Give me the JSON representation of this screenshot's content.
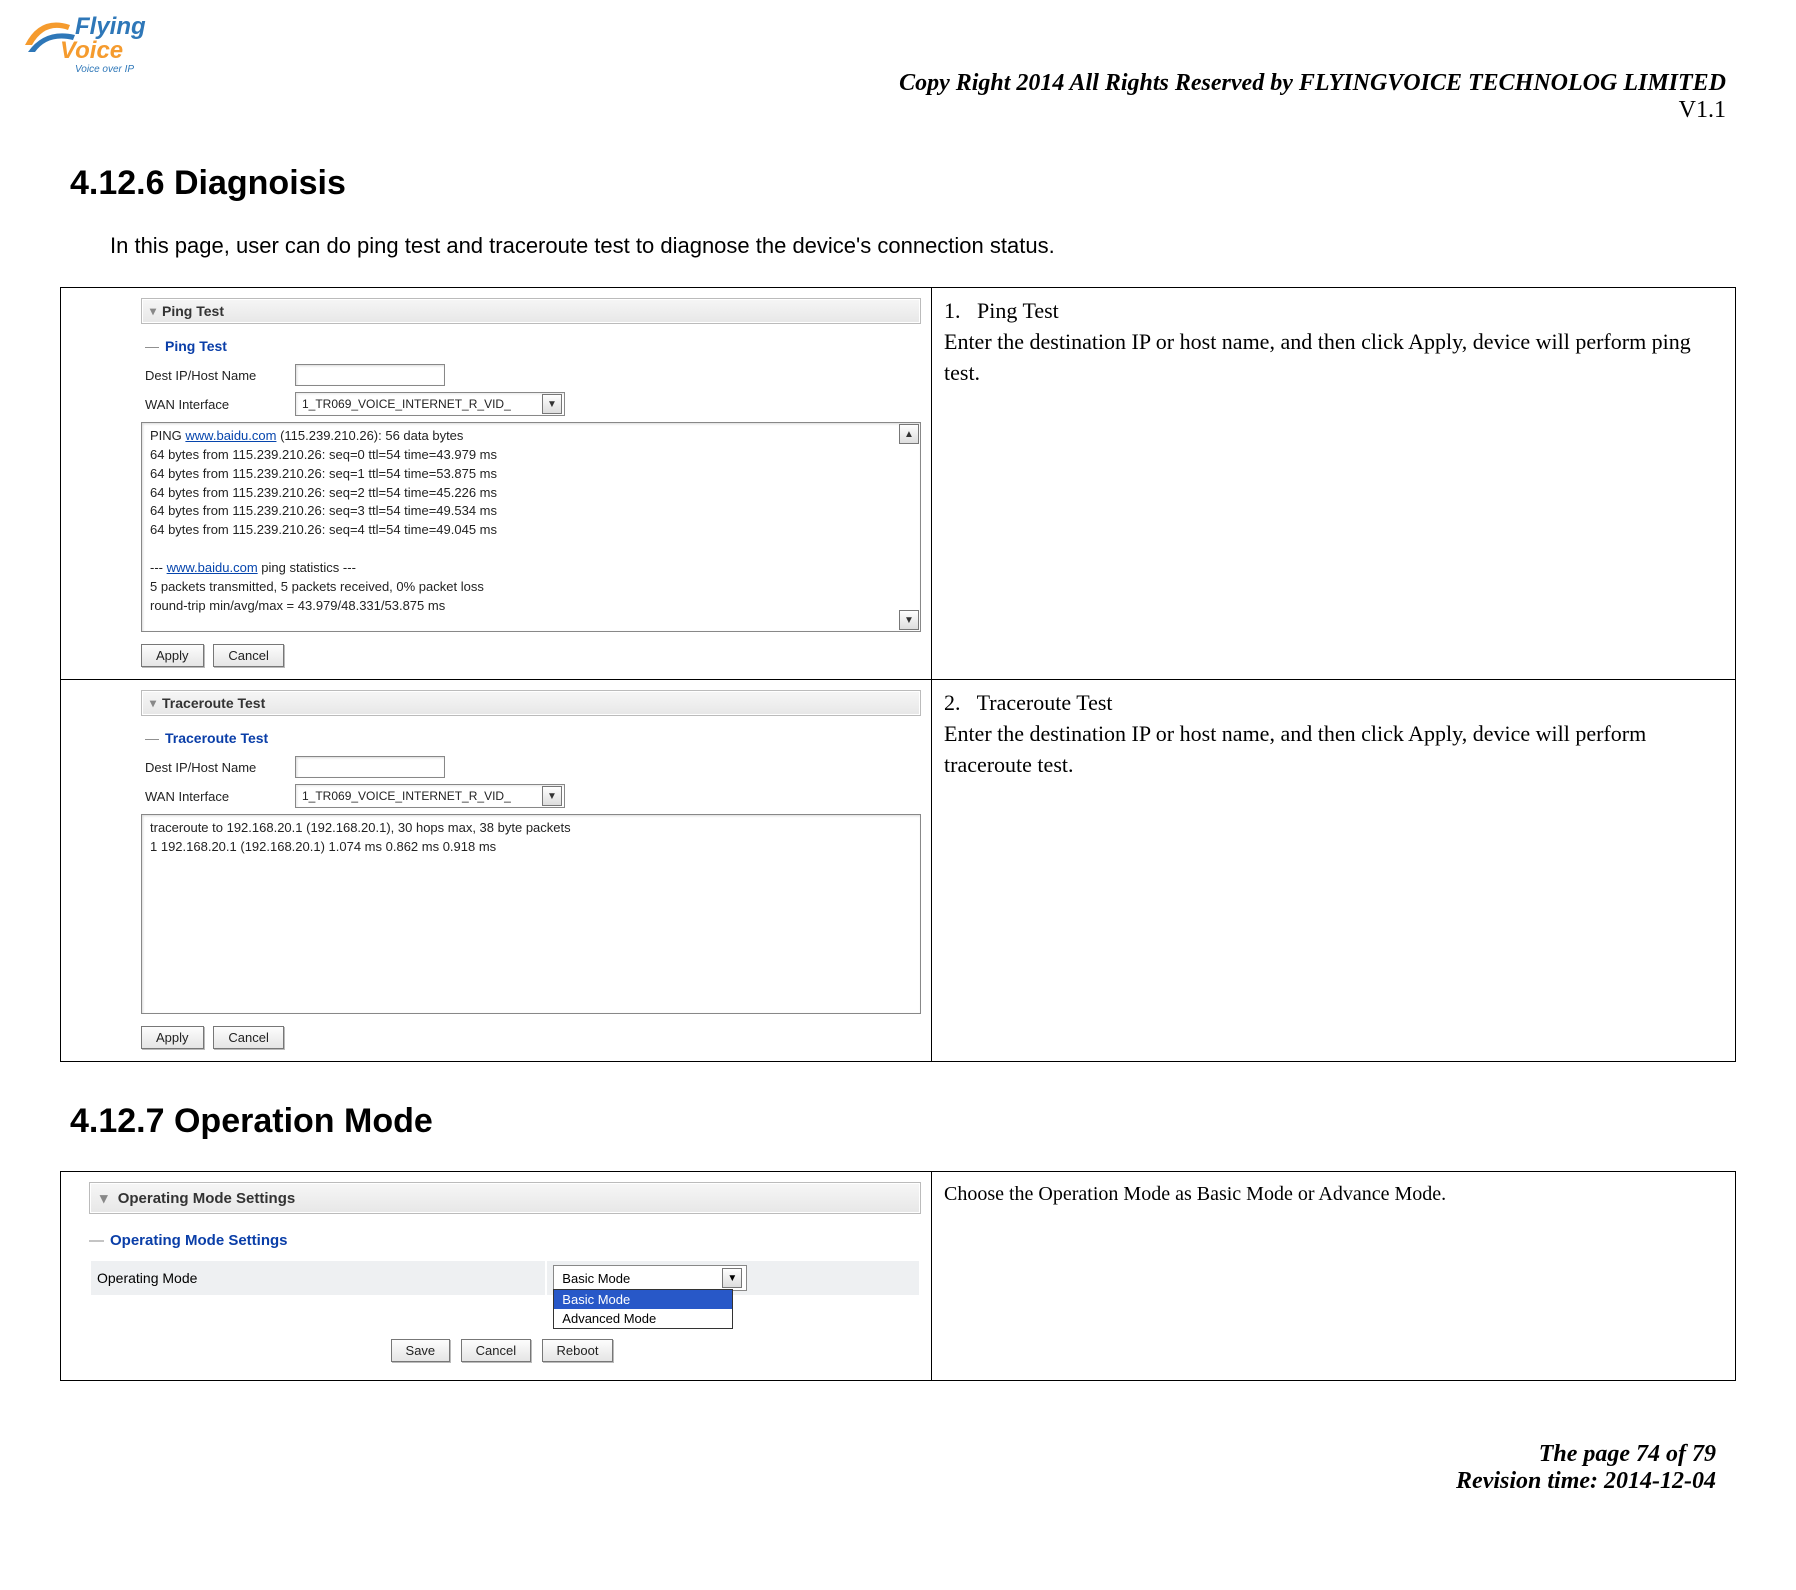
{
  "header": {
    "logo_main": "Flying",
    "logo_sub": "Voice",
    "logo_tag": "Voice over IP",
    "copyright": "Copy Right 2014 All Rights Reserved by FLYINGVOICE TECHNOLOG LIMITED",
    "version": "V1.1"
  },
  "section_diag": {
    "heading": "4.12.6  Diagnoisis",
    "intro": "In this page, user can do ping test and traceroute test to diagnose the device's connection status."
  },
  "ping": {
    "panel_title": "Ping Test",
    "sub_title": "Ping Test",
    "dest_label": "Dest IP/Host Name",
    "dest_value": "",
    "wan_label": "WAN Interface",
    "wan_value": "1_TR069_VOICE_INTERNET_R_VID_",
    "output_lines": [
      {
        "pre": "PING ",
        "link": "www.baidu.com",
        "post": " (115.239.210.26): 56 data bytes"
      },
      {
        "text": "64 bytes from 115.239.210.26: seq=0 ttl=54 time=43.979 ms"
      },
      {
        "text": "64 bytes from 115.239.210.26: seq=1 ttl=54 time=53.875 ms"
      },
      {
        "text": "64 bytes from 115.239.210.26: seq=2 ttl=54 time=45.226 ms"
      },
      {
        "text": "64 bytes from 115.239.210.26: seq=3 ttl=54 time=49.534 ms"
      },
      {
        "text": "64 bytes from 115.239.210.26: seq=4 ttl=54 time=49.045 ms"
      },
      {
        "text": ""
      },
      {
        "pre": "--- ",
        "link": "www.baidu.com",
        "post": " ping statistics ---"
      },
      {
        "text": "5 packets transmitted, 5 packets received, 0% packet loss"
      },
      {
        "text": "round-trip min/avg/max = 43.979/48.331/53.875 ms"
      }
    ],
    "apply_label": "Apply",
    "cancel_label": "Cancel",
    "desc_num": "1.",
    "desc_title": "Ping Test",
    "desc_body": "Enter the destination IP or host name, and then click Apply, device will perform ping test."
  },
  "trace": {
    "panel_title": "Traceroute Test",
    "sub_title": "Traceroute Test",
    "dest_label": "Dest IP/Host Name",
    "dest_value": "",
    "wan_label": "WAN Interface",
    "wan_value": "1_TR069_VOICE_INTERNET_R_VID_",
    "output_lines": [
      {
        "text": "traceroute to 192.168.20.1 (192.168.20.1), 30 hops max, 38 byte packets"
      },
      {
        "text": " 1  192.168.20.1 (192.168.20.1)  1.074 ms  0.862 ms  0.918 ms"
      }
    ],
    "apply_label": "Apply",
    "cancel_label": "Cancel",
    "desc_num": "2.",
    "desc_title": "Traceroute Test",
    "desc_body": "Enter the destination IP or host name, and then click Apply, device will perform traceroute test."
  },
  "section_opmode": {
    "heading": "4.12.7  Operation Mode"
  },
  "opmode": {
    "panel_title": "Operating Mode Settings",
    "sub_title": "Operating Mode Settings",
    "row_label": "Operating Mode",
    "selected": "Basic Mode",
    "options": [
      "Basic Mode",
      "Advanced Mode"
    ],
    "save_label": "Save",
    "cancel_label": "Cancel",
    "reboot_label": "Reboot",
    "desc": "Choose the Operation Mode as Basic Mode or Advance Mode."
  },
  "footer": {
    "page": "The page 74 of 79",
    "rev": "Revision time: 2014-12-04"
  }
}
